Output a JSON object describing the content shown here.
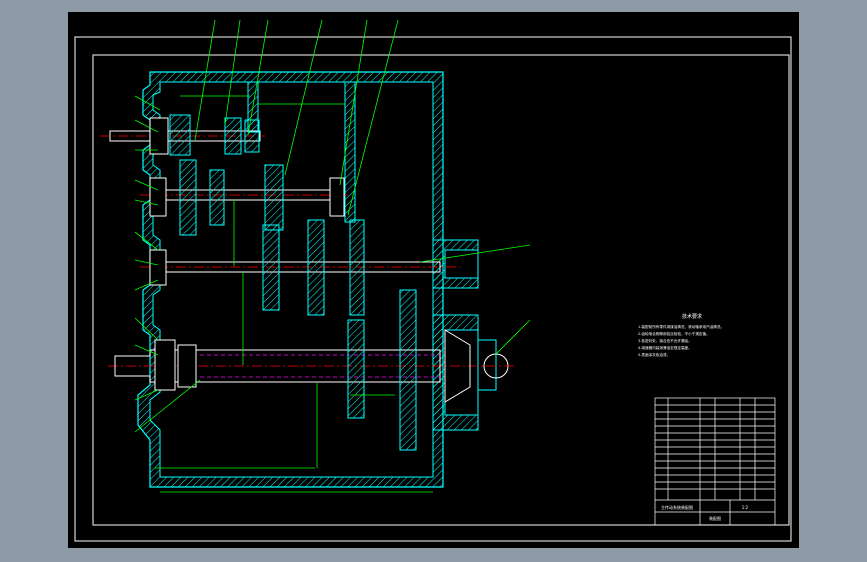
{
  "drawing": {
    "notes_title": "技术要求",
    "notes_lines": [
      "1.装配前所有零件用煤油清洗，滚动轴承用汽油清洗。",
      "2.齿轮啮合侧隙用铅丝检验，不小于规定值。",
      "3.各密封处、接合处不允许漏油。",
      "4.减速器内装润滑油至规定高度。",
      "5.表面涂灰色油漆。"
    ],
    "title_block": {
      "drawing_title": "主传动系统装配图",
      "sheet_id": "装配图",
      "scale": "1:2"
    }
  },
  "colors": {
    "background": "#8e9ba6",
    "sheet": "#000000",
    "housing": "#00ffff",
    "leader": "#00ff00",
    "centerline": "#ff0000",
    "hidden": "#ff00ff",
    "text": "#ffffff"
  }
}
